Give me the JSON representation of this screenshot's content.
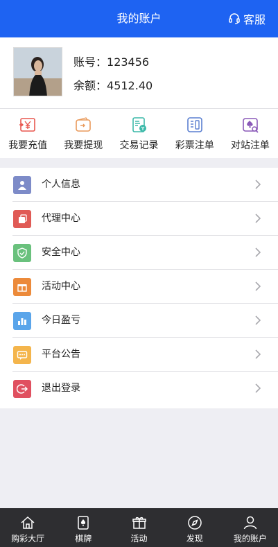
{
  "header": {
    "title": "我的账户",
    "service_label": "客服",
    "color": "#1e63f2"
  },
  "account": {
    "account_label": "账号：",
    "account_value": "123456",
    "balance_label": "余额：",
    "balance_value": "4512.40"
  },
  "actions": [
    {
      "label": "我要充值",
      "icon": "yuan-arrow-icon",
      "color": "#e8564e"
    },
    {
      "label": "我要提现",
      "icon": "wallet-icon",
      "color": "#e99a5b"
    },
    {
      "label": "交易记录",
      "icon": "receipt-icon",
      "color": "#3cb9a9"
    },
    {
      "label": "彩票注单",
      "icon": "ticket-list-icon",
      "color": "#5a7fd0"
    },
    {
      "label": "对站注单",
      "icon": "spade-search-icon",
      "color": "#8a59b8"
    }
  ],
  "menu": [
    {
      "label": "个人信息",
      "icon": "user-icon",
      "color": "#7d8bc8"
    },
    {
      "label": "代理中心",
      "icon": "agent-icon",
      "color": "#e05a55"
    },
    {
      "label": "安全中心",
      "icon": "shield-icon",
      "color": "#6ac17d"
    },
    {
      "label": "活动中心",
      "icon": "gift-icon",
      "color": "#ec8a3a"
    },
    {
      "label": "今日盈亏",
      "icon": "bar-chart-icon",
      "color": "#5aa5ea"
    },
    {
      "label": "平台公告",
      "icon": "message-icon",
      "color": "#f4b54c"
    },
    {
      "label": "退出登录",
      "icon": "logout-icon",
      "color": "#e05060"
    }
  ],
  "bottom_nav": [
    {
      "label": "购彩大厅",
      "icon": "home-icon"
    },
    {
      "label": "棋牌",
      "icon": "cards-icon"
    },
    {
      "label": "活动",
      "icon": "gift-icon"
    },
    {
      "label": "发现",
      "icon": "compass-icon"
    },
    {
      "label": "我的账户",
      "icon": "person-icon"
    }
  ]
}
